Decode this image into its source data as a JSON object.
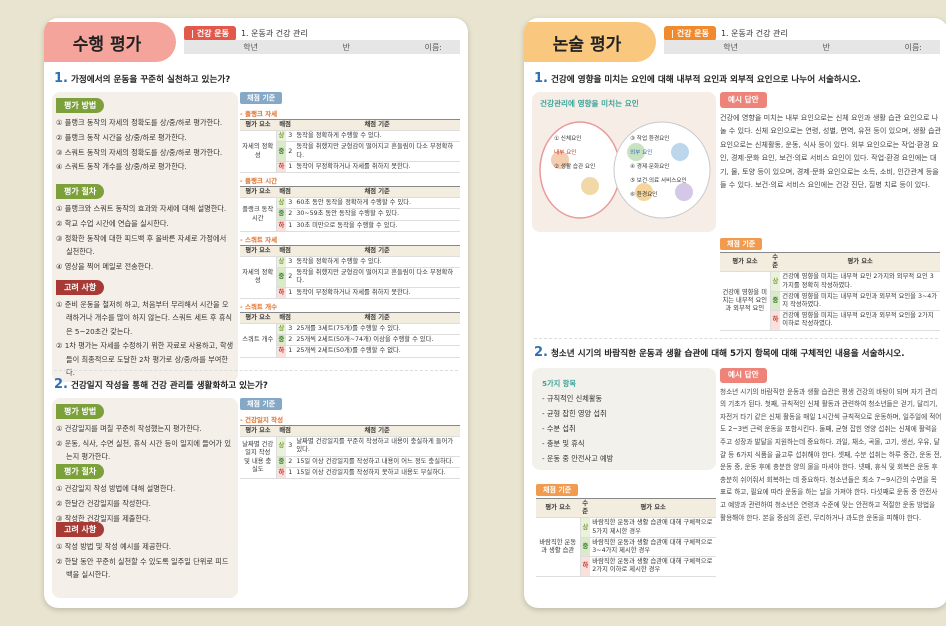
{
  "left": {
    "title": "수행 평가",
    "tag": "| 건강 운동",
    "unit": "1. 운동과 건강 관리",
    "info": [
      "학년",
      "반",
      "이름:"
    ],
    "q1": {
      "num": "1.",
      "text": "가정에서의 운동을 꾸준히 실천하고 있는가?",
      "method_label": "평가 방법",
      "method": [
        "① 플랭크 동작의 자세의 정확도를 상/중/하로 평가한다.",
        "② 플랭크 동작 시간을 상/중/하로 평가한다.",
        "③ 스쿼트 동작의 자세의 정확도를 상/중/하로 평가한다.",
        "④ 스쿼트 동작 개수를 상/중/하로 평가한다."
      ],
      "proc_label": "평가 절차",
      "proc": [
        "① 플랭크와 스쿼트 동작의 효과와 자세에 대해 설명한다.",
        "② 학교 수업 시간에 연습을 실시한다.",
        "③ 정확한 동작에 대한 피드백 후 올바른 자세로 가정에서 실천한다.",
        "④ 영상을 찍어 메일로 전송한다."
      ],
      "cons_label": "고려 사항",
      "cons": [
        "① 준비 운동을 철저히 하고, 처음부터 무리해서 시간을 오래하거나 개수를 많이 하지 않는다. 스쿼트 세트 후 휴식은 5~20초간 갖는다.",
        "② 1차 평가는 자세를 수정하기 위한 자료로 사용하고, 학생들이 최종적으로 도달한 2차 평가로 상/중/하를 부여한다."
      ],
      "table_title": "채점 기준",
      "header": [
        "평가 요소",
        "배점",
        "채점 기준"
      ],
      "groups": [
        {
          "section": "- 플랭크 자세",
          "element": "자세의 정확성",
          "rows": [
            [
              "상",
              "3",
              "동작을 정확하게 수행할 수 있다."
            ],
            [
              "중",
              "2",
              "동작을 취했지만 균형감이 떨어지고 흔들림이 다소 부정확하다."
            ],
            [
              "하",
              "1",
              "동작이 부정확하거나 자세를 취하지 못한다."
            ]
          ]
        },
        {
          "section": "- 플랭크 시간",
          "element": "플랭크 동작 시간",
          "rows": [
            [
              "상",
              "3",
              "60초 동안 동작을 정확하게 수행할 수 있다."
            ],
            [
              "중",
              "2",
              "30~59초 동안 동작을 수행할 수 있다."
            ],
            [
              "하",
              "1",
              "30초 미만으로 동작을 수행할 수 있다."
            ]
          ]
        },
        {
          "section": "- 스쿼트 자세",
          "element": "자세의 정확성",
          "rows": [
            [
              "상",
              "3",
              "동작을 정확하게 수행할 수 있다."
            ],
            [
              "중",
              "2",
              "동작을 취했지만 균형감이 떨어지고 흔들림이 다소 부정확하다."
            ],
            [
              "하",
              "1",
              "동작이 부정확하거나 자세를 취하지 못한다."
            ]
          ]
        },
        {
          "section": "- 스쿼트 개수",
          "element": "스쿼트 개수",
          "rows": [
            [
              "상",
              "3",
              "25개를 3세트(75개)를 수행할 수 있다."
            ],
            [
              "중",
              "2",
              "25개씩 2세트(50개~74개) 이상을 수행할 수 있다."
            ],
            [
              "하",
              "1",
              "25개씩 2세트(50개)를 수행할 수 없다."
            ]
          ]
        }
      ]
    },
    "q2": {
      "num": "2.",
      "text": "건강일지 작성을 통해 건강 관리를 생활화하고 있는가?",
      "method_label": "평가 방법",
      "method": [
        "① 건강일지를 며칠 꾸준히 작성했는지 평가한다.",
        "② 운동, 식사, 수면 실천, 휴식 시간 등이 일지에 들어가 있는지 평가한다."
      ],
      "proc_label": "평가 절차",
      "proc": [
        "① 건강일지 작성 방법에 대해 설명한다.",
        "② 한달간 건강일지를 작성한다.",
        "③ 작성한 건강일지를 제출한다."
      ],
      "cons_label": "고려 사항",
      "cons": [
        "① 작성 방법 및 작성 예시를 제공한다.",
        "② 한달 동안 꾸준히 실천할 수 있도록 일주일 단위로 피드백을 실시한다."
      ],
      "table_title": "채점 기준",
      "section": "- 건강일지 작성",
      "header": [
        "평가 요소",
        "배점",
        "채점 기준"
      ],
      "element": "날짜별 건강일지 작성 및 내용 충실도",
      "rows": [
        [
          "상",
          "3",
          "날짜별 건강일지를 꾸준히 작성하고 내용이 충실하게 들어가 있다."
        ],
        [
          "중",
          "2",
          "15일 이상 건강일지를 작성하고 내용이 어느 정도 충실하다."
        ],
        [
          "하",
          "1",
          "15일 이상 건강일지를 작성하지 못하고 내용도 부실하다."
        ]
      ]
    }
  },
  "right": {
    "title": "논술 평가",
    "tag": "| 건강 운동",
    "unit": "1. 운동과 건강 관리",
    "info": [
      "학년",
      "반",
      "이름:"
    ],
    "q1": {
      "num": "1.",
      "text": "건강에 영향을 미치는 요인에 대해 내부적 요인과 외부적 요인으로 나누어 서술하시오.",
      "diagram_title": "건강관리에 영향을 미치는 요인",
      "diagram": [
        "① 신체요인",
        "내부 요인",
        "② 생활 습관 요인",
        "③ 작업 환경요인",
        "외부 요인",
        "④ 경제·문화요인",
        "⑤ 보건·의료 서비스요인",
        "⑥ 환경요인"
      ],
      "ex_label": "예시 답안",
      "answer": "건강에 영향을 미치는 내부 요인으로는 신체 요인과 생활 습관 요인으로 나눌 수 있다. 신체 요인으로는 연령, 성별, 면역, 유전 등이 있으며, 생활 습관 요인으로는 신체활동, 운동, 식사 등이 있다. 외부 요인으로는 작업·환경 요인, 경제·문화 요인, 보건·의료 서비스 요인이 있다. 작업·환경 요인에는 대기, 물, 토양 등이 있으며, 경제·문화 요인으로는 소득, 소비, 인간관계 등을 들 수 있다. 보건·의료 서비스 요인에는 건강 진단, 질병 치료 등이 있다.",
      "table_title": "채점 기준",
      "header": [
        "평가 요소",
        "수준",
        "평가 요소"
      ],
      "element": "건강에 영향을 미치는 내부적 요인과 외부적 요인",
      "rows": [
        [
          "상",
          "건강에 영향을 미치는 내부적 요인 2가지와 외부적 요인 3가지를 정확히 작성하였다."
        ],
        [
          "중",
          "건강에 영향을 미치는 내부적 요인과 외부적 요인을 3~4가지 작성하였다."
        ],
        [
          "하",
          "건강에 영향을 미치는 내부적 요인과 외부적 요인을 2가지 이하로 작성하였다."
        ]
      ]
    },
    "q2": {
      "num": "2.",
      "text": "청소년 시기의 바람직한 운동과 생활 습관에 대해 5가지 항목에 대해 구체적인 내용을 서술하시오.",
      "items_title": "5가지 항목",
      "items": [
        "- 규칙적인 신체활동",
        "- 균형 잡힌 영양 섭취",
        "- 수분 섭취",
        "- 충분 및 휴식",
        "- 운동 중 안전사고 예방"
      ],
      "ex_label": "예시 답안",
      "answer": "청소년 시기의 바람직한 운동과 생활 습관은 평생 건강의 바탕이 되며 자기 관리의 기초가 된다. 첫째, 규칙적인 신체 활동과 관련하여 청소년들은 걷기, 달리기, 자전거 타기 같은 신체 활동을 매일 1시간씩 규칙적으로 운동하며, 일주일에 적어도 2~3번 근력 운동을 포함시킨다. 둘째, 균형 잡힌 영양 섭취는 신체에 활력을 주고 성장과 발달을 지원하는데 중요하다. 과일, 채소, 곡물, 고기, 생선, 우유, 달걀 등 6가지 식품을 골고루 섭취해야 한다. 셋째, 수분 섭취는 하루 중간, 운동 전, 운동 중, 운동 후에 충분한 양의 물을 마셔야 한다. 넷째, 휴식 및 회복은 운동 후 충분히 쉬어줘서 회복하는 데 중요하다. 청소년들은 최소 7~9시간의 수면을 목표로 하고, 필요에 따라 운동을 하는 날을 가져야 한다. 다섯째로 운동 중 안전사고 예방과 관련하여 청소년은 연령과 수준에 맞는 안전하고 적절한 운동 방법을 활용해야 한다. 본을 중심의 훈련, 무리하거나 과도한 운동을 피해야 한다.",
      "table_title": "채점 기준",
      "header": [
        "평가 요소",
        "수준",
        "평가 요소"
      ],
      "element": "바람직한 운동과 생활 습관",
      "rows": [
        [
          "상",
          "바람직한 운동과 생활 습관에 대해 구체적으로 5가지 제시한 경우"
        ],
        [
          "중",
          "바람직한 운동과 생활 습관에 대해 구체적으로 3~4가지 제시한 경우"
        ],
        [
          "하",
          "바람직한 운동과 생활 습관에 대해 구체적으로 2가지 이하로 제시한 경우"
        ]
      ]
    }
  }
}
